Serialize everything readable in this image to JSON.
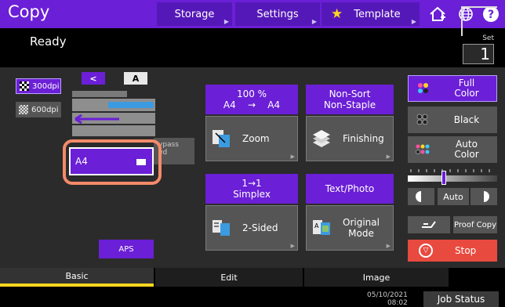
{
  "header": {
    "title": "Copy",
    "tabs": [
      {
        "label": "Storage"
      },
      {
        "label": "Settings"
      },
      {
        "label": "Template"
      }
    ]
  },
  "status": {
    "text": "Ready",
    "set_label": "Set",
    "set_value": "1"
  },
  "left_panel": {
    "resolution": [
      {
        "label": "300dpi",
        "selected": true
      },
      {
        "label": "600dpi",
        "selected": false
      }
    ],
    "bypass_label": "ypass\ned",
    "tray_label": "A4",
    "aps_label": "APS"
  },
  "functions": {
    "zoom_head_line1": "100 %",
    "zoom_head_line2": "A4    →    A4",
    "zoom_label": "Zoom",
    "finishing_head_line1": "Non-Sort",
    "finishing_head_line2": "Non-Staple",
    "finishing_label": "Finishing",
    "simplex_head_line1": "1→1",
    "simplex_head_line2": "Simplex",
    "sided_label": "2-Sided",
    "text_head": "Text/Photo",
    "original_line1": "Original",
    "original_line2": "Mode"
  },
  "color": {
    "full_line1": "Full",
    "full_line2": "Color",
    "black": "Black",
    "auto_line1": "Auto",
    "auto_line2": "Color",
    "density_auto": "Auto",
    "density_level": 0.4
  },
  "controls": {
    "proof_copy": "Proof Copy",
    "stop": "Stop"
  },
  "bottom_tabs": [
    {
      "label": "Basic"
    },
    {
      "label": "Edit"
    },
    {
      "label": "Image"
    }
  ],
  "footer": {
    "date": "05/10/2021",
    "time": "08:02",
    "job_status": "Job Status"
  },
  "colors": {
    "accent": "#6b1fd6",
    "stop": "#e84a3f",
    "highlight": "#f48a6a",
    "tab_indicator": "#ffd61f"
  }
}
